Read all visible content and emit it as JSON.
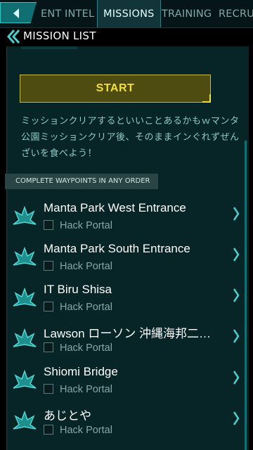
{
  "tabs": [
    {
      "label": "ENT",
      "active": false
    },
    {
      "label": "INTEL",
      "active": false
    },
    {
      "label": "MISSIONS",
      "active": true
    },
    {
      "label": "TRAINING",
      "active": false
    },
    {
      "label": "RECRU",
      "active": false
    }
  ],
  "back_icon": "back-arrow-icon",
  "header": {
    "title": "MISSION LIST",
    "icon": "double-chevron-left-icon"
  },
  "start_label": "START",
  "description": "ミッションクリアするといいことあるかもｗマンタ公園ミッションクリア後、そのままインぐれずぜんざいを食べよう！",
  "order_label": "COMPLETE WAYPOINTS IN ANY ORDER",
  "waypoints": [
    {
      "name": "Manta Park West Entrance",
      "task": "Hack Portal",
      "done": false
    },
    {
      "name": "Manta Park South Entrance",
      "task": "Hack Portal",
      "done": false
    },
    {
      "name": "IT Biru Shisa",
      "task": "Hack Portal",
      "done": false
    },
    {
      "name": "Lawson ローソン 沖縄海邦二…",
      "task": "Hack Portal",
      "done": false
    },
    {
      "name": "Shiomi Bridge",
      "task": "Hack Portal",
      "done": false
    },
    {
      "name": "あじとや",
      "task": "Hack Portal",
      "done": false
    }
  ],
  "icons": {
    "waypoint": "portal-icon",
    "arrow": "chevron-right-icon"
  },
  "colors": {
    "accent": "#35c4c4",
    "start_text": "#f2df3d",
    "start_bg": "#4e4c10",
    "panel_bg": "#072426",
    "desc_text": "#8fcbc8"
  }
}
